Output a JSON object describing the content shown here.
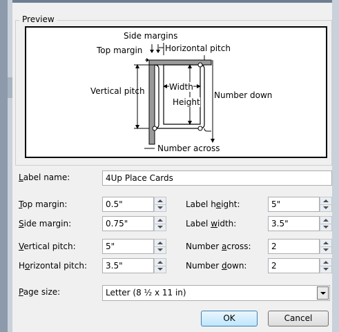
{
  "preview": {
    "group_label": "Preview",
    "labels": {
      "side_margins": "Side margins",
      "top_margin": "Top margin",
      "horizontal_pitch": "Horizontal pitch",
      "vertical_pitch": "Vertical pitch",
      "width": "Width",
      "height": "Height",
      "number_down": "Number down",
      "number_across": "Number across"
    }
  },
  "form": {
    "label_name": {
      "label": "Label name:",
      "value": "4Up Place Cards"
    },
    "top_margin": {
      "label": "Top margin:",
      "value": "0.5\""
    },
    "label_height": {
      "label": "Label height:",
      "value": "5\""
    },
    "side_margin": {
      "label": "Side margin:",
      "value": "0.75\""
    },
    "label_width": {
      "label": "Label width:",
      "value": "3.5\""
    },
    "vertical_pitch": {
      "label": "Vertical pitch:",
      "value": "5\""
    },
    "number_across": {
      "label": "Number across:",
      "value": "2"
    },
    "horizontal_pitch": {
      "label": "Horizontal pitch:",
      "value": "3.5\""
    },
    "number_down": {
      "label": "Number down:",
      "value": "2"
    },
    "page_size": {
      "label": "Page size:",
      "value": "Letter (8 ½ x 11 in)"
    }
  },
  "buttons": {
    "ok": "OK",
    "cancel": "Cancel"
  },
  "icons": {
    "spin_up": "spin-up-arrow-icon",
    "spin_down": "spin-down-arrow-icon",
    "dropdown": "chevron-down-icon"
  }
}
